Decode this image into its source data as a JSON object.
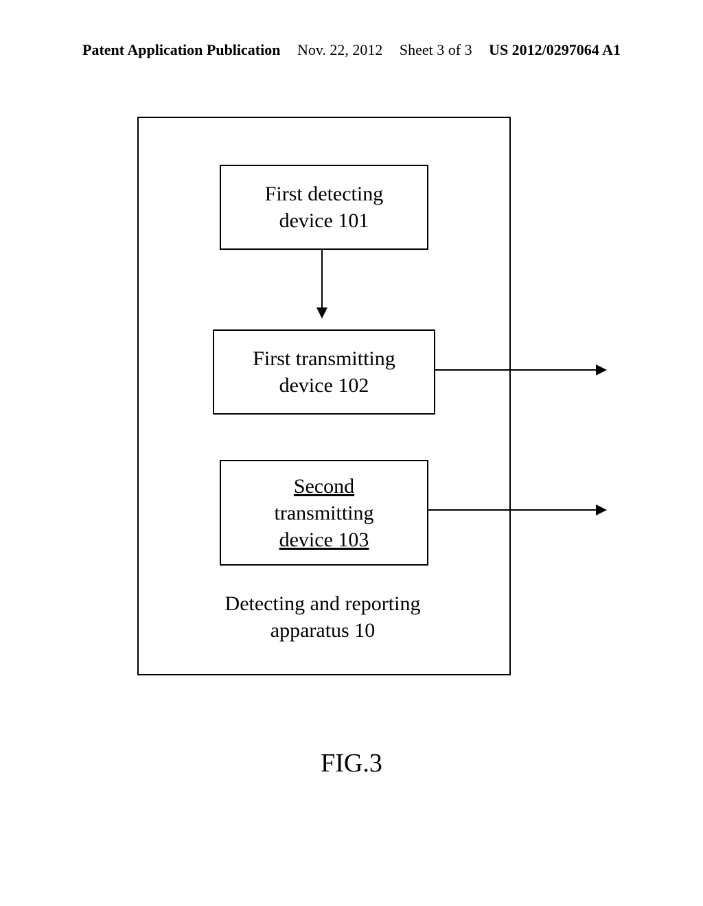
{
  "header": {
    "left": "Patent Application Publication",
    "date": "Nov. 22, 2012",
    "sheet": "Sheet 3 of 3",
    "pubno": "US 2012/0297064 A1"
  },
  "boxes": {
    "box1_line1": "First detecting",
    "box1_line2": "device 101",
    "box2_line1": "First transmitting",
    "box2_line2": "device 102",
    "box3_line1": "Second",
    "box3_line2": "transmitting",
    "box3_line3": "device 103"
  },
  "apparatus": {
    "line1": "Detecting and reporting",
    "line2": "apparatus 10"
  },
  "figure": "FIG.3"
}
